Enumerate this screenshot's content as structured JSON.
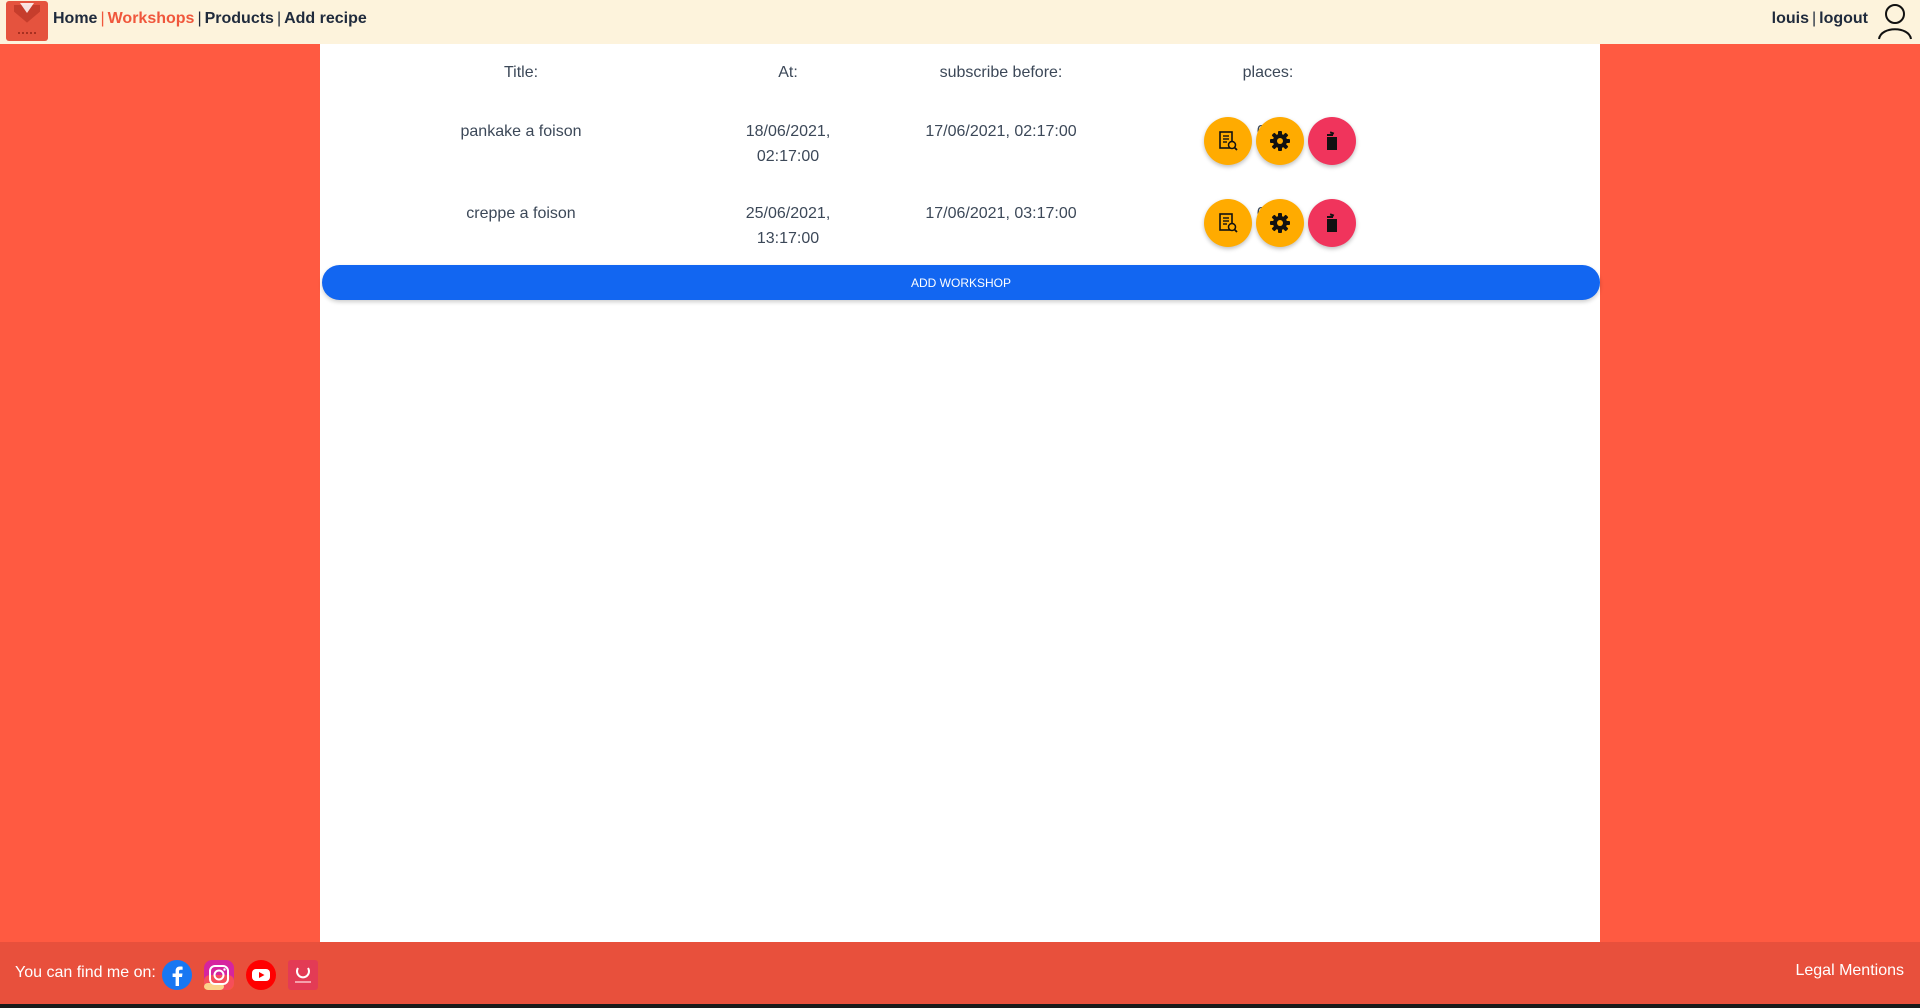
{
  "header": {
    "nav": [
      {
        "label": "Home",
        "active": false
      },
      {
        "label": "Workshops",
        "active": true
      },
      {
        "label": "Products",
        "active": false
      },
      {
        "label": "Add recipe",
        "active": false
      }
    ],
    "separator": "|",
    "user": "louis",
    "logout": "logout"
  },
  "table": {
    "headers": [
      "Title:",
      "At:",
      "subscribe before:",
      "places:"
    ],
    "rows": [
      {
        "title": "pankake a foison",
        "at_date": "18/06/2021,",
        "at_time": "02:17:00",
        "subscribe_before": "17/06/2021, 02:17:00",
        "places": "0/3"
      },
      {
        "title": "creppe a foison",
        "at_date": "25/06/2021,",
        "at_time": "13:17:00",
        "subscribe_before": "17/06/2021, 03:17:00",
        "places": "0/6"
      }
    ],
    "actions": [
      "view-icon",
      "gear-icon",
      "trash-icon"
    ],
    "add_button": "ADD WORKSHOP"
  },
  "footer": {
    "find_text": "You can find me on:",
    "socials": [
      "facebook-icon",
      "instagram-icon",
      "youtube-icon",
      "brand-icon"
    ],
    "legal": "Legal Mentions"
  },
  "colors": {
    "background": "#ff5a41",
    "header": "#fdf3dc",
    "active_nav": "#f0573c",
    "action_orange": "#ffab00",
    "action_pink": "#f0345c",
    "add_button": "#1266f1",
    "footer": "#e8503c"
  }
}
